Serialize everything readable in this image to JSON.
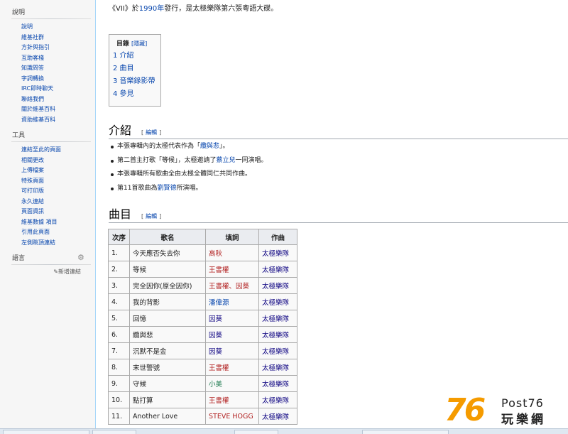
{
  "sidebar": {
    "help": {
      "heading": "說明",
      "items": [
        "說明",
        "維基社群",
        "方針與指引",
        "互助客棧",
        "知識問答",
        "字詞轉換",
        "IRC即時聊天",
        "聯絡我們",
        "關於維基百科",
        "資助維基百科"
      ]
    },
    "tools": {
      "heading": "工具",
      "items": [
        "連結至此的頁面",
        "相關更改",
        "上傳檔案",
        "特殊頁面",
        "可打印版",
        "永久連結",
        "頁面資訊",
        "維基數據 項目",
        "引用此頁面",
        "左側跳頂連結"
      ]
    },
    "languages": {
      "heading": "語言",
      "add_links": "✎新增連結"
    }
  },
  "intro": {
    "t1": "《VII》於",
    "year": "1990年",
    "t2": "發行，是太極樂隊第六張粵語大碟。"
  },
  "toc": {
    "title": "目錄",
    "hide": "[隱藏]",
    "items": [
      "1 介紹",
      "2 曲目",
      "3 音樂錄影帶",
      "4 參見"
    ]
  },
  "sections": {
    "intro_title": "介紹",
    "tracks_title": "曲目",
    "edit_open": "[",
    "edit": "編輯",
    "edit_close": "]"
  },
  "bullets": [
    {
      "text": "本張專輯內的太極代表作為「",
      "link": "纜與悲",
      "tail": "」。"
    },
    {
      "text": "第二首主打歌「等候」，太極邀請了",
      "link": "蔡立兒",
      "tail": "一同演唱。"
    },
    {
      "text": "本張專輯所有歌曲全由太極全體同仁共同作曲。",
      "link": "",
      "tail": ""
    },
    {
      "text": "第11首歌曲為",
      "link": "劉賢德",
      "tail": "所演唱。"
    }
  ],
  "table": {
    "headers": [
      "次序",
      "歌名",
      "填詞",
      "作曲"
    ],
    "rows": [
      {
        "no": "1.",
        "song": "今天應否失去你",
        "lyricist": "高秋",
        "composer": "太極樂隊"
      },
      {
        "no": "2.",
        "song": "等候",
        "lyricist": "王書權",
        "composer": "太極樂隊"
      },
      {
        "no": "3.",
        "song": "完全因你(原全因你)",
        "lyricist": "王書權、因葵",
        "composer": "太極樂隊"
      },
      {
        "no": "4.",
        "song": "我的背影",
        "lyricist": "潘偉源",
        "composer": "太極樂隊"
      },
      {
        "no": "5.",
        "song": "回憶",
        "lyricist": "因葵",
        "composer": "太極樂隊"
      },
      {
        "no": "6.",
        "song": "纜與悲",
        "lyricist": "因葵",
        "composer": "太極樂隊"
      },
      {
        "no": "7.",
        "song": "沉默不是金",
        "lyricist": "因葵",
        "composer": "太極樂隊"
      },
      {
        "no": "8.",
        "song": "末世警號",
        "lyricist": "王書權",
        "composer": "太極樂隊"
      },
      {
        "no": "9.",
        "song": "守候",
        "lyricist": "小美",
        "composer": "太極樂隊"
      },
      {
        "no": "10.",
        "song": "點打算",
        "lyricist": "王書權",
        "composer": "太極樂隊"
      },
      {
        "no": "11.",
        "song": "Another Love",
        "lyricist": "STEVE HOGG",
        "composer": "太極樂隊"
      }
    ]
  },
  "watermark": {
    "number": "76",
    "post": "Post76",
    "cn": "玩樂網"
  },
  "colors": {
    "link": "#0645ad",
    "redlink": "#b22222",
    "logo_orange": "#f59b00"
  }
}
